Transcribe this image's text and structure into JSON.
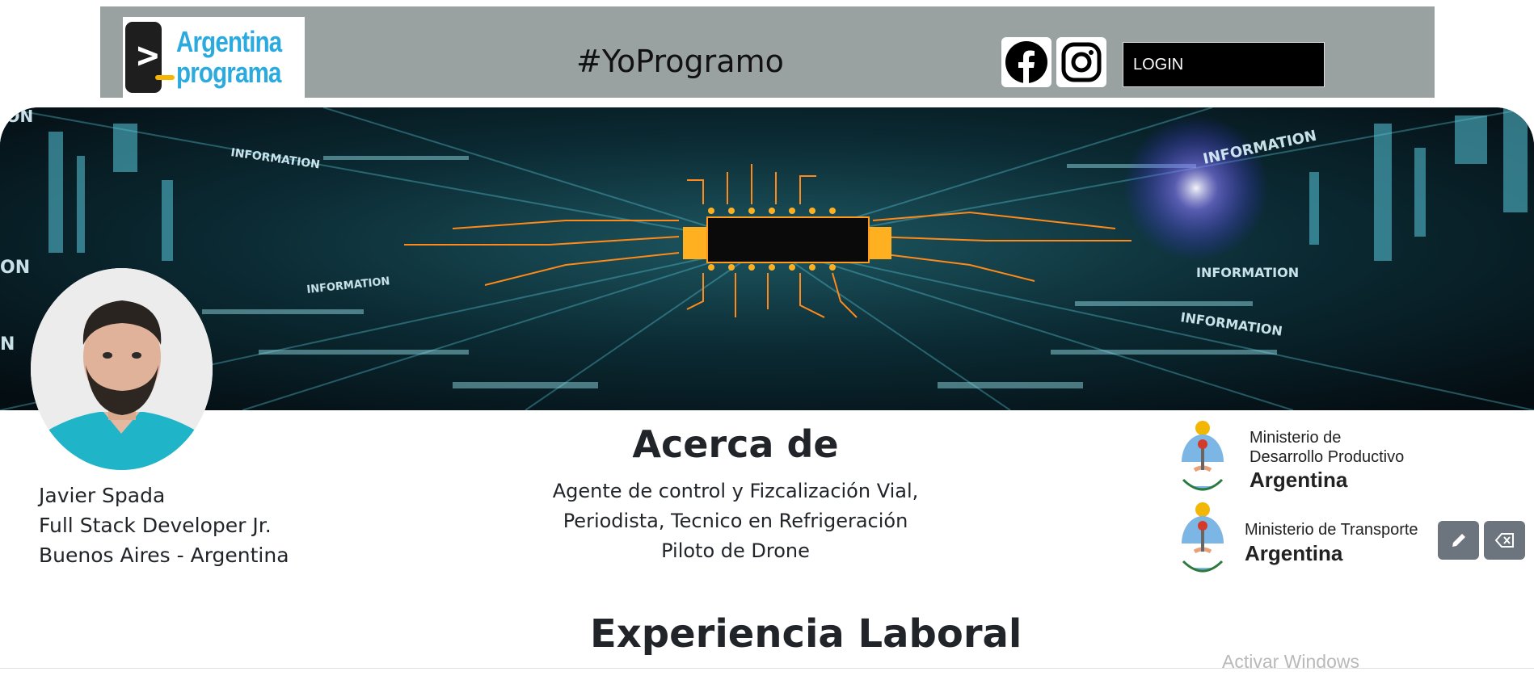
{
  "navbar": {
    "logo_line1": "Argentina",
    "logo_line2": "programa",
    "brand": "#YoProgramo",
    "login_label": "LOGIN",
    "social": [
      "facebook-icon",
      "instagram-icon"
    ]
  },
  "profile": {
    "name": "Javier Spada",
    "role": "Full Stack Developer Jr.",
    "location": "Buenos Aires - Argentina"
  },
  "about": {
    "title": "Acerca de",
    "line1": "Agente de control y Fizcalización Vial,",
    "line2": "Periodista, Tecnico en Refrigeración",
    "line3": "Piloto de Drone"
  },
  "ministries": [
    {
      "line1": "Ministerio de",
      "line2": "Desarrollo Productivo",
      "line3": "Argentina"
    },
    {
      "line1": "Ministerio de Transporte",
      "line2": "Argentina"
    }
  ],
  "actions": {
    "edit": "pencil-icon",
    "delete": "backspace-icon"
  },
  "experience": {
    "title": "Experiencia Laboral"
  },
  "watermark": "Activar Windows",
  "banner": {
    "words": [
      "ION",
      "INFORMATION",
      "INFORMATION",
      "INFORMATION",
      "INFORMATION",
      "INFORMATION",
      "ON",
      "N"
    ]
  },
  "colors": {
    "navbar": "#9aa1a1",
    "logo_text": "#2aaadf",
    "button": "#6c757d",
    "chip_leads": "#ff9a1a"
  }
}
